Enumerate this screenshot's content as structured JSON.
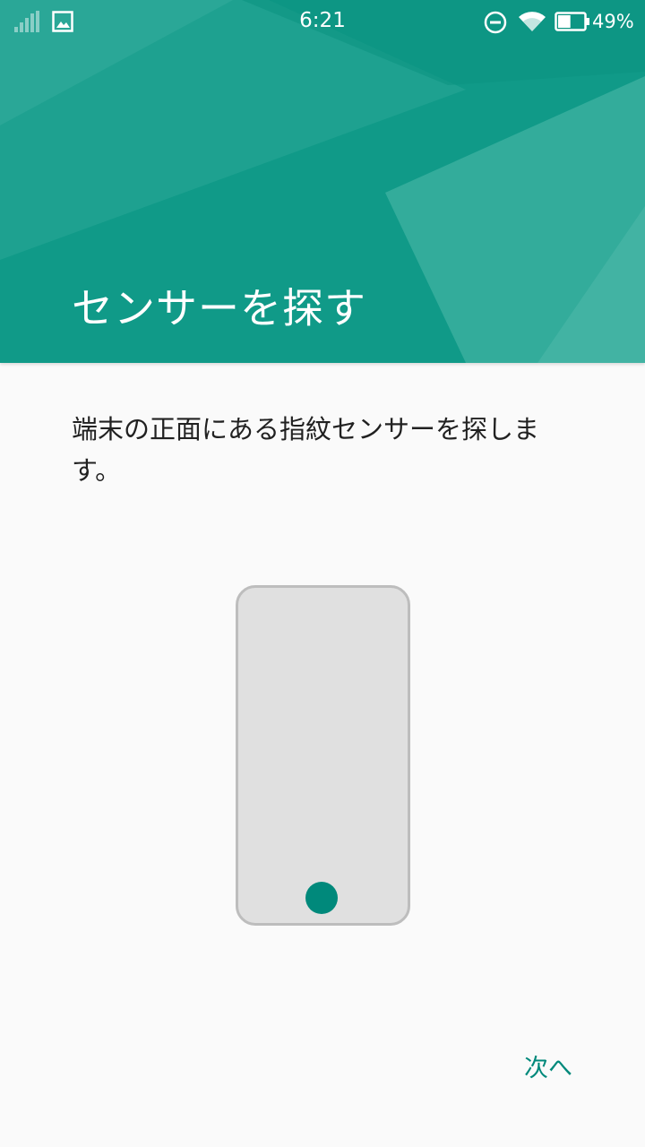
{
  "status_bar": {
    "time": "6:21",
    "battery_percent": "49%",
    "battery_level": 0.49,
    "icons": [
      "signal-icon",
      "image-icon",
      "do-not-disturb-icon",
      "wifi-icon",
      "battery-icon"
    ]
  },
  "header": {
    "title": "センサーを探す",
    "color": "#0f9a88"
  },
  "body": {
    "description": "端末の正面にある指紋センサーを探します。"
  },
  "illustration": {
    "sensor_color": "#00897b"
  },
  "footer": {
    "next_label": "次へ",
    "accent_color": "#00897b"
  }
}
